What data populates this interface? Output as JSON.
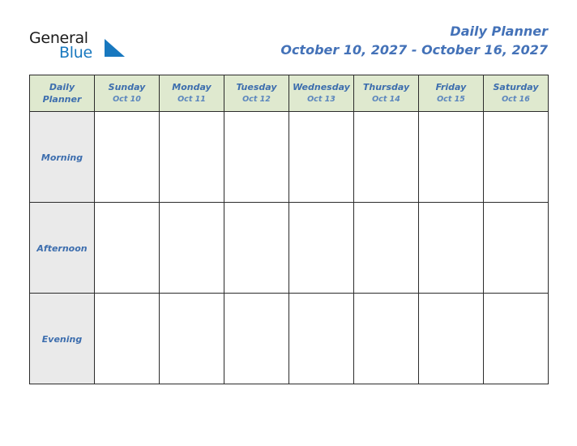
{
  "brand": {
    "name_part1": "General",
    "name_part2": "Blue",
    "triangle_color": "#1878bf",
    "text_color": "#1b1b1b"
  },
  "header": {
    "title": "Daily Planner",
    "date_range": "October 10, 2027 - October 16, 2027",
    "title_color": "#4472b8"
  },
  "table": {
    "corner_label_line1": "Daily",
    "corner_label_line2": "Planner",
    "header_background": "#dfe9cf",
    "rowlabel_background": "#eaeaea",
    "border_color": "#2b2b2b",
    "day_text_color": "#3d6eae",
    "date_text_color": "#5b86bd",
    "columns": [
      {
        "day": "Sunday",
        "date": "Oct 10"
      },
      {
        "day": "Monday",
        "date": "Oct 11"
      },
      {
        "day": "Tuesday",
        "date": "Oct 12"
      },
      {
        "day": "Wednesday",
        "date": "Oct 13"
      },
      {
        "day": "Thursday",
        "date": "Oct 14"
      },
      {
        "day": "Friday",
        "date": "Oct 15"
      },
      {
        "day": "Saturday",
        "date": "Oct 16"
      }
    ],
    "rows": [
      {
        "label": "Morning",
        "cells": [
          "",
          "",
          "",
          "",
          "",
          "",
          ""
        ]
      },
      {
        "label": "Afternoon",
        "cells": [
          "",
          "",
          "",
          "",
          "",
          "",
          ""
        ]
      },
      {
        "label": "Evening",
        "cells": [
          "",
          "",
          "",
          "",
          "",
          "",
          ""
        ]
      }
    ]
  }
}
